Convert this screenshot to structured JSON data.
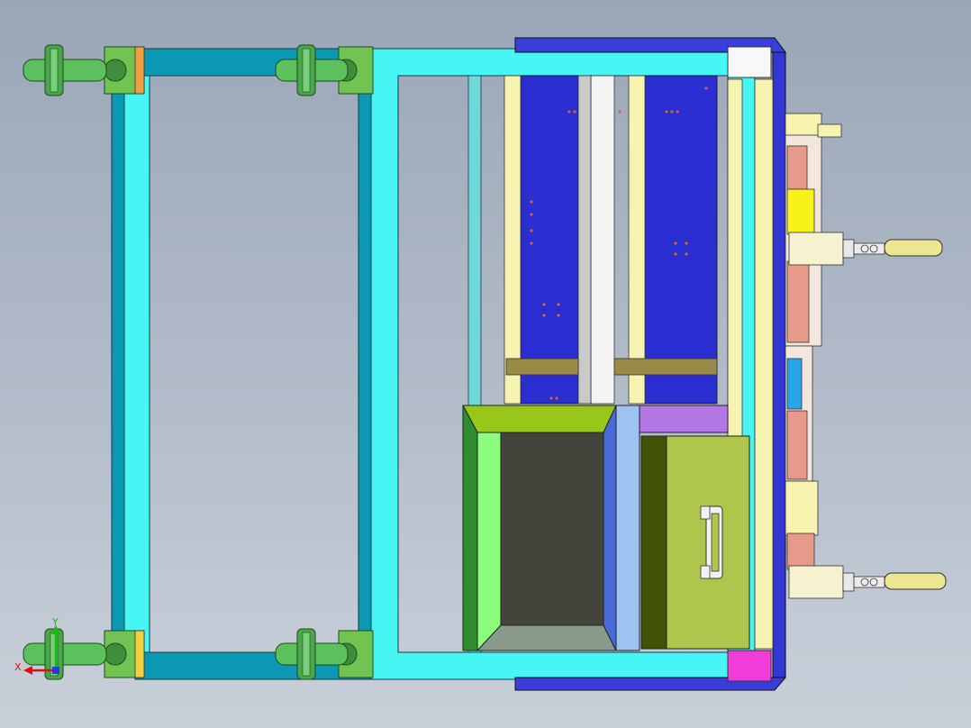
{
  "viewport": {
    "background_top": "#9aa6b8",
    "background_bottom": "#c9d0da"
  },
  "model": {
    "colors": {
      "frame_cyan": "#47f5f5",
      "frame_teal": "#0a98b4",
      "mold_plate_blue": "#2a2ed0",
      "rail_yellow": "#f6f2b0",
      "caster_green": "#5cc05c",
      "drawer_olive": "#aec64c",
      "tray_dark": "#44443c",
      "handle_yellow": "#ece690",
      "accent_magenta": "#f23cd8",
      "accent_purple": "#b478e6",
      "accent_light_blue": "#9ec2f2",
      "heater_red": "#e89a8a"
    },
    "parts": {
      "caster_icon": "caster-wheel",
      "drawer_handle_icon": "drawer-handle",
      "clamp_handle_icon": "clamp-handle"
    }
  },
  "triad": {
    "x_label": "X",
    "y_label": "Y",
    "x_color": "#e01010",
    "y_color": "#10c010"
  }
}
